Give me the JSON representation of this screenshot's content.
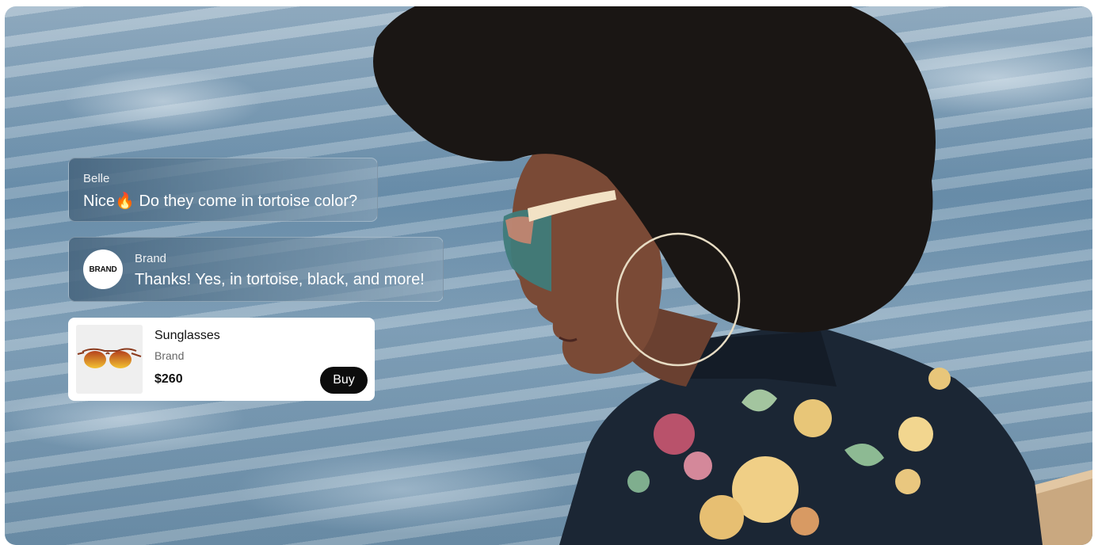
{
  "chat": {
    "messages": [
      {
        "sender": "Belle",
        "text": "Nice🔥 Do they come in tortoise color?"
      },
      {
        "sender": "Brand",
        "avatar_text": "BRAND",
        "text": "Thanks! Yes, in tortoise, black, and more!"
      }
    ]
  },
  "product": {
    "name": "Sunglasses",
    "brand": "Brand",
    "price": "$260",
    "buy_label": "Buy",
    "thumbnail_icon": "sunglasses-icon"
  },
  "colors": {
    "bubble_tint": "#5f7d94",
    "card_bg": "#ffffff",
    "buy_button_bg": "#0c0c0c",
    "water": "#7c9db5"
  }
}
